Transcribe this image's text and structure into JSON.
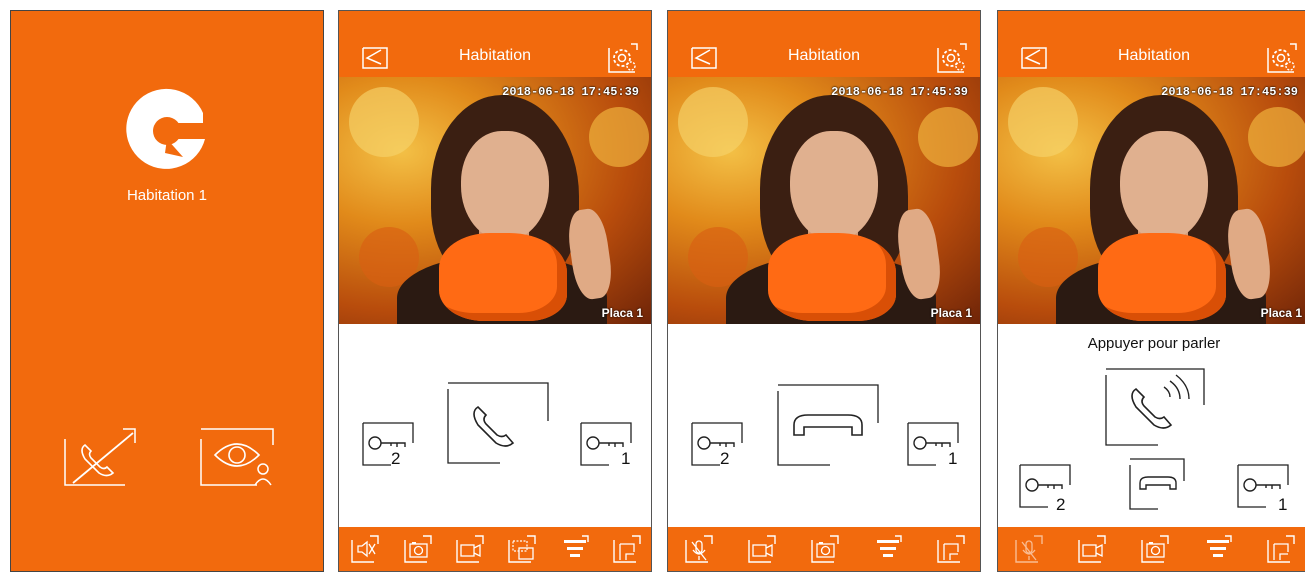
{
  "splash": {
    "home_label": "Habitation 1"
  },
  "screens": [
    {
      "title": "Habitation",
      "timestamp": "2018-06-18 17:45:39",
      "camera": "Placa 1",
      "key_left": "2",
      "key_right": "1"
    },
    {
      "title": "Habitation",
      "timestamp": "2018-06-18 17:45:39",
      "camera": "Placa 1",
      "key_left": "2",
      "key_right": "1"
    },
    {
      "title": "Habitation",
      "timestamp": "2018-06-18 17:45:39",
      "camera": "Placa 1",
      "key_left": "2",
      "key_right": "1",
      "speak_prompt": "Appuyer pour parler"
    }
  ],
  "colors": {
    "brand_orange": "#f26a0d",
    "outline": "#222222",
    "white": "#ffffff"
  },
  "icons": {
    "splash": [
      "call-off-icon",
      "monitor-eye-icon"
    ],
    "screen2_toolbar": [
      "speaker-mute-icon",
      "camera-snapshot-icon",
      "video-record-icon",
      "camera-switch-icon",
      "menu-filter-icon",
      "door-exit-icon"
    ],
    "screen3_toolbar": [
      "mic-mute-icon",
      "video-record-icon",
      "camera-snapshot-icon",
      "menu-filter-icon",
      "door-exit-icon"
    ],
    "screen4_toolbar": [
      "mic-mute-icon",
      "video-record-icon",
      "camera-snapshot-icon",
      "menu-filter-icon",
      "door-exit-icon"
    ]
  }
}
